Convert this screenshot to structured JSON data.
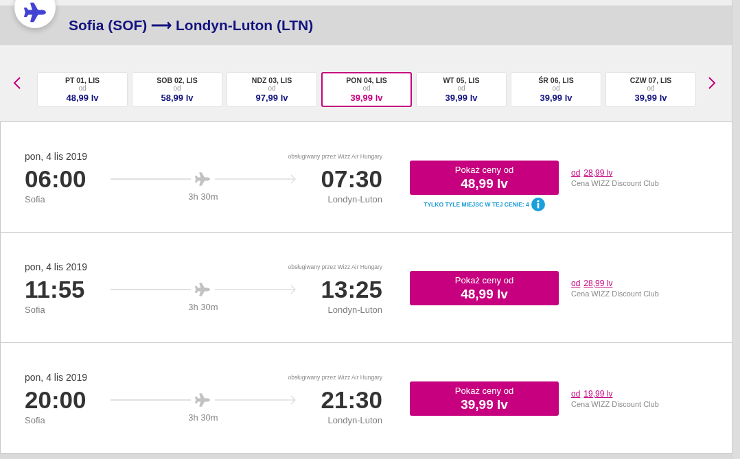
{
  "route_header": {
    "title": "Sofia (SOF) ⟶ Londyn-Luton (LTN)"
  },
  "date_selector": {
    "days": [
      {
        "day": "PT 01, LIS",
        "from_label": "od",
        "price": "48,99 lv",
        "selected": false
      },
      {
        "day": "SOB 02, LIS",
        "from_label": "od",
        "price": "58,99 lv",
        "selected": false
      },
      {
        "day": "NDZ 03, LIS",
        "from_label": "od",
        "price": "97,99 lv",
        "selected": false
      },
      {
        "day": "PON 04, LIS",
        "from_label": "od",
        "price": "39,99 lv",
        "selected": true
      },
      {
        "day": "WT 05, LIS",
        "from_label": "od",
        "price": "39,99 lv",
        "selected": false
      },
      {
        "day": "ŚR 06, LIS",
        "from_label": "od",
        "price": "39,99 lv",
        "selected": false
      },
      {
        "day": "CZW 07, LIS",
        "from_label": "od",
        "price": "39,99 lv",
        "selected": false
      }
    ]
  },
  "flights": [
    {
      "date": "pon, 4 lis 2019",
      "operator": "obsługiwany przez Wizz Air Hungary",
      "departure_time": "06:00",
      "departure_city": "Sofia",
      "duration": "3h 30m",
      "arrival_time": "07:30",
      "arrival_city": "Londyn-Luton",
      "button_label": "Pokaż ceny od",
      "price": "48,99 lv",
      "seats_notice": "TYLKO TYLE MIEJSC W TEJ CENIE: 4",
      "club_from": "od",
      "club_price": "28,99 lv",
      "club_label": "Cena WIZZ Discount Club"
    },
    {
      "date": "pon, 4 lis 2019",
      "operator": "obsługiwany przez Wizz Air Hungary",
      "departure_time": "11:55",
      "departure_city": "Sofia",
      "duration": "3h 30m",
      "arrival_time": "13:25",
      "arrival_city": "Londyn-Luton",
      "button_label": "Pokaż ceny od",
      "price": "48,99 lv",
      "club_from": "od",
      "club_price": "28,99 lv",
      "club_label": "Cena WIZZ Discount Club"
    },
    {
      "date": "pon, 4 lis 2019",
      "operator": "obsługiwany przez Wizz Air Hungary",
      "departure_time": "20:00",
      "departure_city": "Sofia",
      "duration": "3h 30m",
      "arrival_time": "21:30",
      "arrival_city": "Londyn-Luton",
      "button_label": "Pokaż ceny od",
      "price": "39,99 lv",
      "club_from": "od",
      "club_price": "19,99 lv",
      "club_label": "Cena WIZZ Discount Club"
    }
  ]
}
